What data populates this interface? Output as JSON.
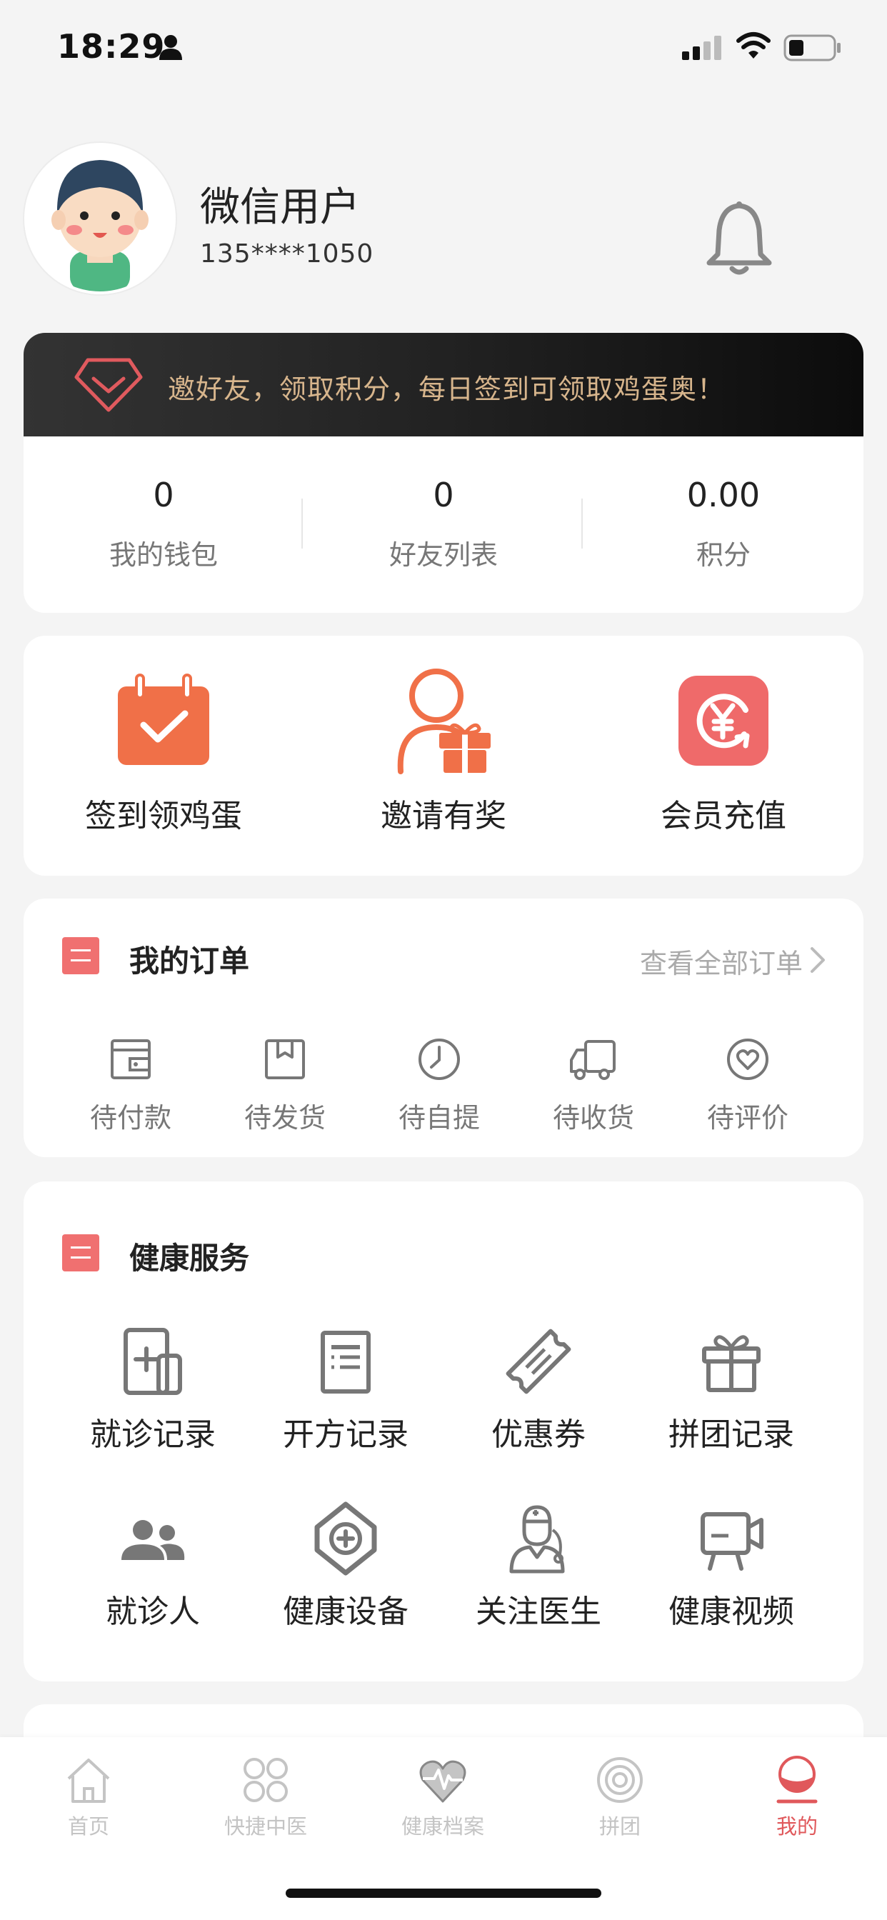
{
  "status_bar": {
    "time": "18:29",
    "icons": [
      "person-icon",
      "signal-icon",
      "wifi-icon",
      "battery-icon"
    ]
  },
  "profile": {
    "name": "微信用户",
    "phone": "135****1050",
    "icons": [
      "avatar",
      "bell-icon"
    ]
  },
  "invite": {
    "text": "邀好友，领取积分，每日签到可领取鸡蛋奥！",
    "icon": "diamond-icon"
  },
  "stats": [
    {
      "value": "0",
      "label": "我的钱包"
    },
    {
      "value": "0",
      "label": "好友列表"
    },
    {
      "value": "0.00",
      "label": "积分"
    }
  ],
  "quick_actions": [
    {
      "label": "签到领鸡蛋",
      "icon": "calendar-check-icon"
    },
    {
      "label": "邀请有奖",
      "icon": "user-gift-icon"
    },
    {
      "label": "会员充值",
      "icon": "yen-recharge-icon"
    }
  ],
  "orders": {
    "title": "我的订单",
    "view_all": "查看全部订单",
    "items": [
      {
        "label": "待付款",
        "icon": "wallet-icon"
      },
      {
        "label": "待发货",
        "icon": "package-icon"
      },
      {
        "label": "待自提",
        "icon": "clock-icon"
      },
      {
        "label": "待收货",
        "icon": "truck-icon"
      },
      {
        "label": "待评价",
        "icon": "heart-icon"
      }
    ]
  },
  "health": {
    "title": "健康服务",
    "items": [
      {
        "label": "就诊记录",
        "icon": "medical-record-icon"
      },
      {
        "label": "开方记录",
        "icon": "prescription-icon"
      },
      {
        "label": "优惠券",
        "icon": "coupon-icon"
      },
      {
        "label": "拼团记录",
        "icon": "gift-box-icon"
      },
      {
        "label": "就诊人",
        "icon": "patients-icon"
      },
      {
        "label": "健康设备",
        "icon": "plus-device-icon"
      },
      {
        "label": "关注医生",
        "icon": "doctor-icon"
      },
      {
        "label": "健康视频",
        "icon": "video-camera-icon"
      }
    ]
  },
  "tabbar": {
    "active": "我的",
    "active_color": "#e0585b",
    "items": [
      {
        "label": "首页",
        "icon": "home-icon"
      },
      {
        "label": "快捷中医",
        "icon": "grid-circles-icon"
      },
      {
        "label": "健康档案",
        "icon": "heart-pulse-icon"
      },
      {
        "label": "拼团",
        "icon": "target-icon"
      },
      {
        "label": "我的",
        "icon": "profile-icon"
      }
    ]
  },
  "colors": {
    "accent": "#e0585b",
    "section_badge": "#f07070",
    "orange": "#f07048",
    "banner_text": "#d7b58c"
  }
}
